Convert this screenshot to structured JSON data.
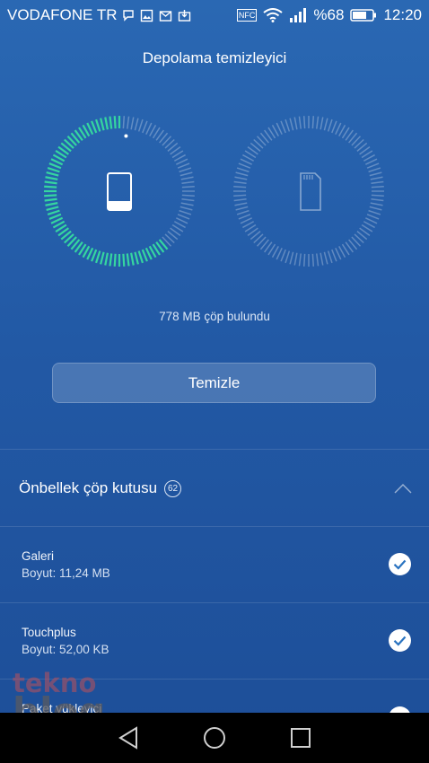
{
  "status_bar": {
    "carrier": "VODAFONE TR",
    "battery": "%68",
    "time": "12:20",
    "nfc": "NFC"
  },
  "app": {
    "title": "Depolama temizleyici"
  },
  "storage": {
    "phone_used_fraction": 0.62,
    "sd_used_fraction": 0.0,
    "accent_color": "#35d6a0",
    "found_text": "778 MB çöp bulundu"
  },
  "actions": {
    "clean_label": "Temizle"
  },
  "cache_section": {
    "title": "Önbellek çöp kutusu",
    "count": "62",
    "items": [
      {
        "name": "Galeri",
        "size": "Boyut: 11,24 MB"
      },
      {
        "name": "Touchplus",
        "size": "Boyut: 52,00 KB"
      },
      {
        "name": "Paket yükleyici",
        "size": ""
      }
    ]
  },
  "watermark": {
    "top": "tekno",
    "bottom": "blog"
  }
}
